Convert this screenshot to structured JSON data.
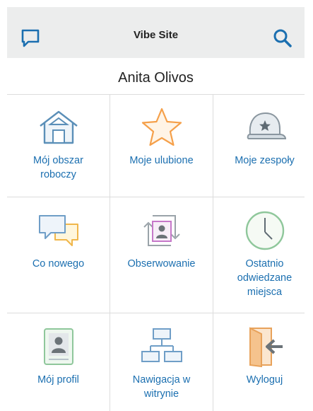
{
  "header": {
    "title": "Vibe Site"
  },
  "user": {
    "name": "Anita Olivos"
  },
  "tiles": [
    {
      "label": "Mój obszar roboczy",
      "icon": "home-icon"
    },
    {
      "label": "Moje ulubione",
      "icon": "star-icon"
    },
    {
      "label": "Moje zespoły",
      "icon": "team-cap-icon"
    },
    {
      "label": "Co nowego",
      "icon": "speech-bubbles-icon"
    },
    {
      "label": "Obserwowanie",
      "icon": "follow-icon"
    },
    {
      "label": "Ostatnio odwiedzane miejsca",
      "icon": "clock-icon"
    },
    {
      "label": "Mój profil",
      "icon": "profile-icon"
    },
    {
      "label": "Nawigacja w witrynie",
      "icon": "sitemap-icon"
    },
    {
      "label": "Wyloguj",
      "icon": "logout-door-icon"
    }
  ],
  "colors": {
    "accent": "#1b6fb0",
    "topbar_bg": "#eceded",
    "divider": "#dcdcdc"
  }
}
